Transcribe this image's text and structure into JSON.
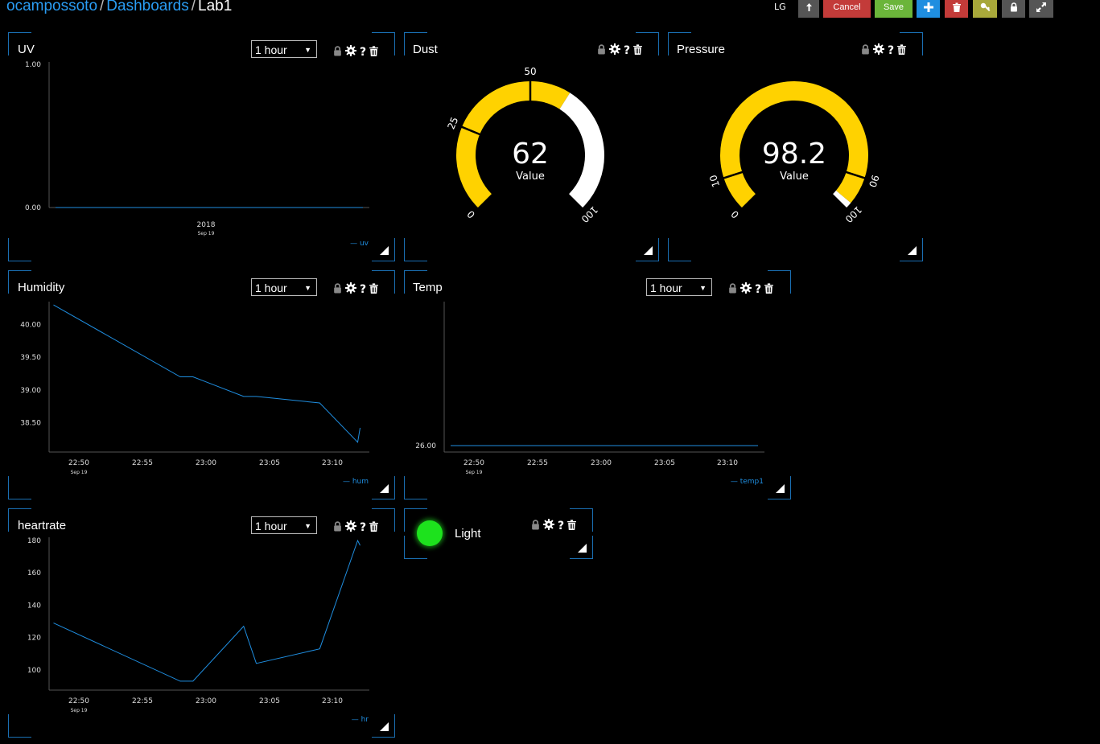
{
  "breadcrumb": {
    "user": "ocampossoto",
    "dashboards": "Dashboards",
    "current": "Lab1"
  },
  "toolbar": {
    "lg": "LG",
    "cancel": "Cancel",
    "save": "Save",
    "colors": {
      "cancel": "#c33b39",
      "save": "#6bb53a",
      "add": "#1f8ee0",
      "delete": "#c33b39",
      "key": "#a8a83a",
      "lock": "#555555",
      "expand": "#555555",
      "upload": "#555555"
    }
  },
  "widgets": {
    "uv": {
      "title": "UV",
      "range": "1 hour",
      "legend": "— uv"
    },
    "dust": {
      "title": "Dust",
      "value": "62",
      "label": "Value"
    },
    "pressure": {
      "title": "Pressure",
      "value": "98.2",
      "label": "Value"
    },
    "humidity": {
      "title": "Humidity",
      "range": "1 hour",
      "legend": "— hum"
    },
    "temp": {
      "title": "Temp",
      "range": "1 hour",
      "legend": "— temp1"
    },
    "heartrate": {
      "title": "heartrate",
      "range": "1 hour",
      "legend": "— hr"
    },
    "light": {
      "title": "Light",
      "color": "#1de21d"
    }
  },
  "chart_data": [
    {
      "type": "line",
      "title": "UV",
      "series": [
        {
          "name": "uv",
          "x": [
            "22:48",
            "23:12"
          ],
          "values": [
            0,
            0
          ]
        }
      ],
      "yticks": [
        "1.00",
        "0.00"
      ],
      "ylim": [
        0,
        1
      ],
      "xticks": [
        "2018"
      ],
      "xsub": "Sep 19",
      "color": "#1f8ee0"
    },
    {
      "type": "gauge",
      "title": "Dust",
      "value": 62,
      "min": 0,
      "max": 100,
      "ticks": [
        "0",
        "25",
        "50",
        "100"
      ],
      "colors": [
        "#ffd200",
        "#ffffff"
      ]
    },
    {
      "type": "gauge",
      "title": "Pressure",
      "value": 98.2,
      "min": 0,
      "max": 100,
      "ticks": [
        "0",
        "10",
        "90",
        "100"
      ],
      "colors": [
        "#ffd200",
        "#ffffff"
      ]
    },
    {
      "type": "line",
      "title": "Humidity",
      "series": [
        {
          "name": "hum",
          "x": [
            "22:48",
            "22:58",
            "22:59",
            "23:03",
            "23:04",
            "23:09",
            "23:12",
            "23:12.3"
          ],
          "values": [
            40.3,
            39.2,
            39.2,
            38.9,
            38.9,
            38.8,
            38.2,
            38.42
          ]
        }
      ],
      "yticks": [
        "40.00",
        "39.50",
        "39.00",
        "38.50"
      ],
      "ylim": [
        38.05,
        40.35
      ],
      "xticks": [
        "22:50",
        "22:55",
        "23:00",
        "23:05",
        "23:10"
      ],
      "xsub": "Sep 19",
      "color": "#1f8ee0"
    },
    {
      "type": "line",
      "title": "Temp",
      "series": [
        {
          "name": "temp1",
          "x": [
            "22:48",
            "23:12"
          ],
          "values": [
            26,
            26
          ]
        }
      ],
      "yticks": [
        "26.00"
      ],
      "xticks": [
        "22:50",
        "22:55",
        "23:00",
        "23:05",
        "23:10"
      ],
      "xsub": "Sep 19",
      "color": "#1f8ee0"
    },
    {
      "type": "line",
      "title": "heartrate",
      "series": [
        {
          "name": "hr",
          "x": [
            "22:48",
            "22:58",
            "22:59",
            "23:03",
            "23:04",
            "23:09",
            "23:12",
            "23:12.3"
          ],
          "values": [
            129,
            93,
            93,
            127,
            104,
            113,
            180,
            177
          ]
        }
      ],
      "yticks": [
        "180",
        "160",
        "140",
        "120",
        "100"
      ],
      "ylim": [
        87.5,
        182
      ],
      "xticks": [
        "22:50",
        "22:55",
        "23:00",
        "23:05",
        "23:10"
      ],
      "xsub": "Sep 19",
      "color": "#1f8ee0"
    }
  ]
}
